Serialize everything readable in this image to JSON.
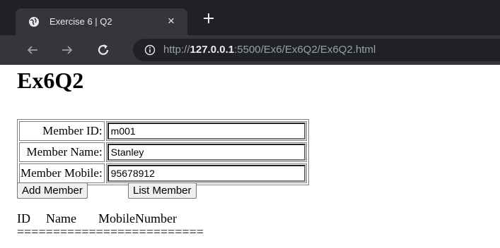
{
  "browser": {
    "tab_title": "Exercise 6 | Q2",
    "tab_close": "×",
    "url_scheme": "http://",
    "url_host": "127.0.0.1",
    "url_path": ":5500/Ex6/Ex6Q2/Ex6Q2.html"
  },
  "page": {
    "heading": "Ex6Q2",
    "form": {
      "member_id_label": "Member ID:",
      "member_id_value": "m001",
      "member_name_label": "Member Name:",
      "member_name_value": "Stanley",
      "member_mobile_label": "Member Mobile:",
      "member_mobile_value": "95678912"
    },
    "buttons": {
      "add_member": "Add Member",
      "list_member": "List Member"
    },
    "list": {
      "col_id": "ID",
      "col_name": "Name",
      "col_mobile": "MobileNumber",
      "separator": "=========================="
    }
  },
  "colors": {
    "chrome_dark": "#202124",
    "chrome_tab": "#35363a",
    "chrome_text": "#e8eaed"
  }
}
